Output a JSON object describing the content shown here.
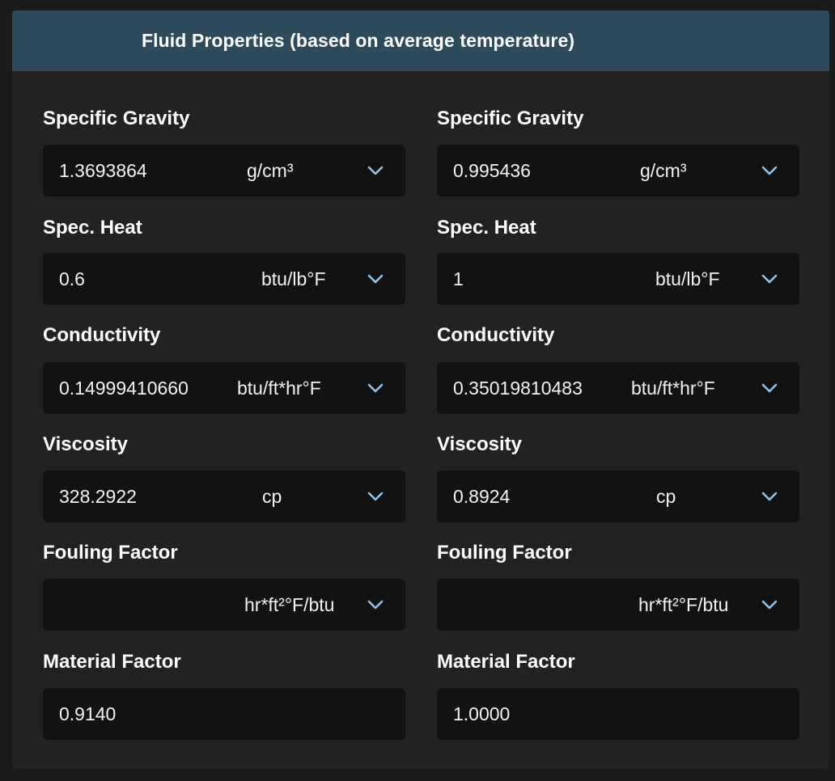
{
  "header": {
    "title": "Fluid Properties (based on average temperature)"
  },
  "icons": {
    "dropdown": "chevron-down-icon"
  },
  "colors": {
    "header_bg": "#2d4b5d",
    "panel_bg": "#222222",
    "field_bg": "#121212",
    "chevron": "#8fc3f0"
  },
  "left": {
    "specific_gravity": {
      "label": "Specific Gravity",
      "value": "1.3693864",
      "unit": "g/cm³"
    },
    "spec_heat": {
      "label": "Spec. Heat",
      "value": "0.6",
      "unit": "btu/lb°F"
    },
    "conductivity": {
      "label": "Conductivity",
      "value": "0.14999410660",
      "unit": "btu/ft*hr°F"
    },
    "viscosity": {
      "label": "Viscosity",
      "value": "328.2922",
      "unit": "cp"
    },
    "fouling_factor": {
      "label": "Fouling Factor",
      "value": "",
      "unit": "hr*ft²°F/btu"
    },
    "material_factor": {
      "label": "Material Factor",
      "value": "0.9140"
    }
  },
  "right": {
    "specific_gravity": {
      "label": "Specific Gravity",
      "value": "0.995436",
      "unit": "g/cm³"
    },
    "spec_heat": {
      "label": "Spec. Heat",
      "value": "1",
      "unit": "btu/lb°F"
    },
    "conductivity": {
      "label": "Conductivity",
      "value": "0.35019810483",
      "unit": "btu/ft*hr°F"
    },
    "viscosity": {
      "label": "Viscosity",
      "value": "0.8924",
      "unit": "cp"
    },
    "fouling_factor": {
      "label": "Fouling Factor",
      "value": "",
      "unit": "hr*ft²°F/btu"
    },
    "material_factor": {
      "label": "Material Factor",
      "value": "1.0000"
    }
  }
}
